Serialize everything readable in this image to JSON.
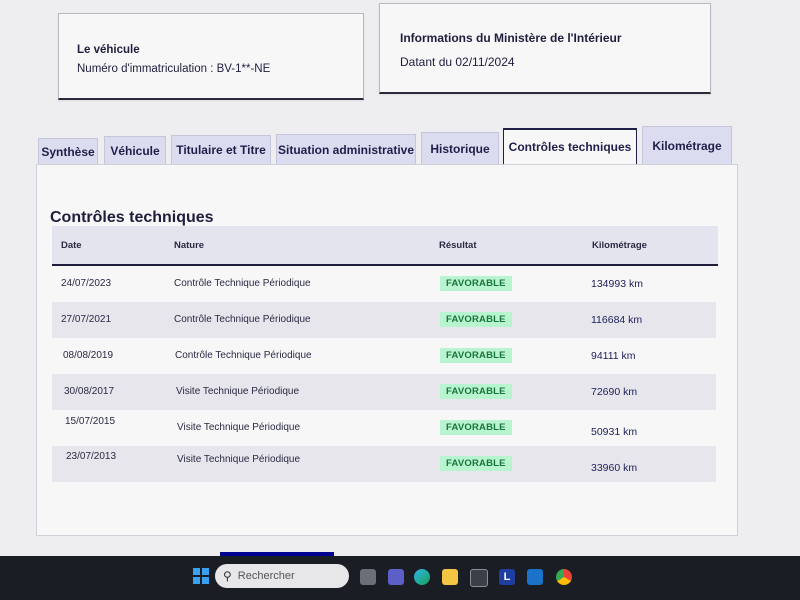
{
  "vehicle_card": {
    "title": "Le véhicule",
    "plate": "Numéro d'immatriculation : BV-1**-NE"
  },
  "ministry_card": {
    "title": "Informations du Ministère de l'Intérieur",
    "date": "Datant du 02/11/2024"
  },
  "tabs": [
    {
      "label": "Synthèse"
    },
    {
      "label": "Véhicule"
    },
    {
      "label": "Titulaire et Titre"
    },
    {
      "label": "Situation administrative"
    },
    {
      "label": "Historique"
    },
    {
      "label": "Contrôles techniques"
    },
    {
      "label": "Kilométrage"
    }
  ],
  "active_tab": "Contrôles techniques",
  "section": {
    "title": "Contrôles techniques",
    "columns": [
      "Date",
      "Nature",
      "Résultat",
      "Kilométrage"
    ],
    "rows": [
      {
        "date": "24/07/2023",
        "nature": "Contrôle Technique Périodique",
        "result": "FAVORABLE",
        "km": "134993 km"
      },
      {
        "date": "27/07/2021",
        "nature": "Contrôle Technique Périodique",
        "result": "FAVORABLE",
        "km": "116684 km"
      },
      {
        "date": "08/08/2019",
        "nature": "Contrôle Technique Périodique",
        "result": "FAVORABLE",
        "km": "94111 km"
      },
      {
        "date": "30/08/2017",
        "nature": "Visite Technique Périodique",
        "result": "FAVORABLE",
        "km": "72690 km"
      },
      {
        "date": "15/07/2015",
        "nature": "Visite Technique Périodique",
        "result": "FAVORABLE",
        "km": "50931 km"
      },
      {
        "date": "23/07/2013",
        "nature": "Visite Technique Périodique",
        "result": "FAVORABLE",
        "km": "33960 km"
      }
    ]
  },
  "taskbar": {
    "search_placeholder": "Rechercher",
    "icons": [
      "windows-icon",
      "search-icon",
      "task-view-icon",
      "teams-icon",
      "edge-icon",
      "file-explorer-icon",
      "store-icon",
      "l-app-icon",
      "mail-icon",
      "chrome-icon"
    ]
  },
  "colors": {
    "accent": "#000091",
    "badge_bg": "#b8f4cf",
    "badge_text": "#18753c"
  }
}
